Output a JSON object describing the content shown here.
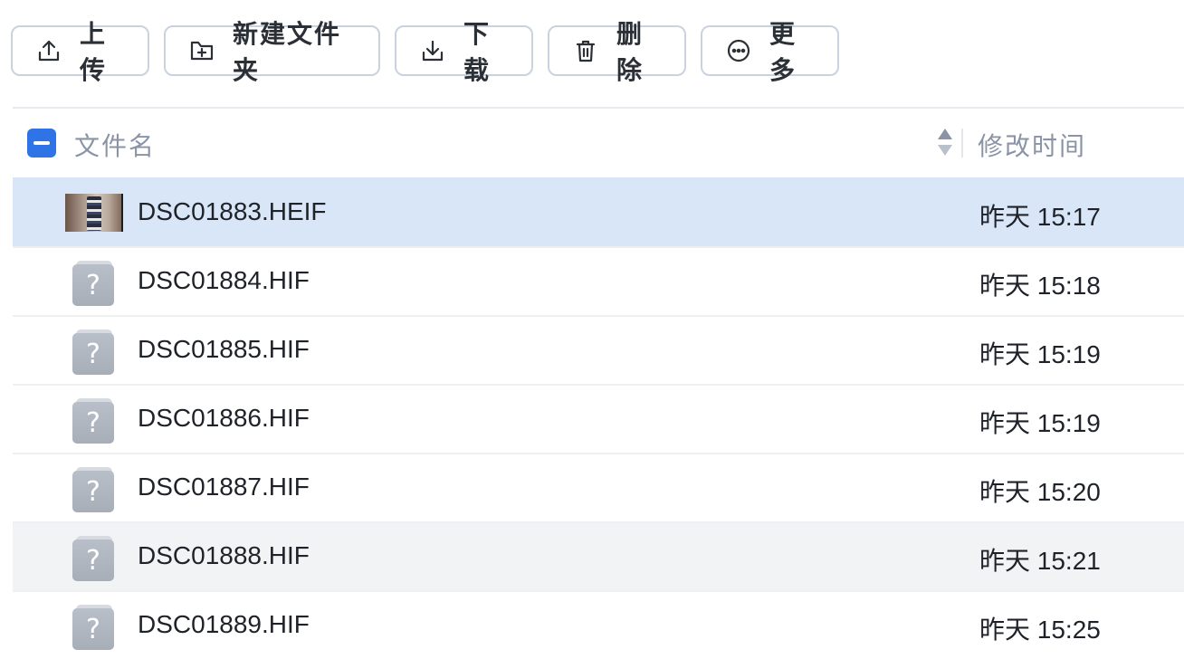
{
  "toolbar": {
    "upload_label": "上传",
    "new_folder_label": "新建文件夹",
    "download_label": "下载",
    "delete_label": "删除",
    "more_label": "更多"
  },
  "table": {
    "header": {
      "name_label": "文件名",
      "time_label": "修改时间"
    },
    "rows": [
      {
        "name": "DSC01883.HEIF",
        "time": "昨天 15:17",
        "icon": "photo-thumbnail"
      },
      {
        "name": "DSC01884.HIF",
        "time": "昨天 15:18",
        "icon": "unknown-file-icon"
      },
      {
        "name": "DSC01885.HIF",
        "time": "昨天 15:19",
        "icon": "unknown-file-icon"
      },
      {
        "name": "DSC01886.HIF",
        "time": "昨天 15:19",
        "icon": "unknown-file-icon"
      },
      {
        "name": "DSC01887.HIF",
        "time": "昨天 15:20",
        "icon": "unknown-file-icon"
      },
      {
        "name": "DSC01888.HIF",
        "time": "昨天 15:21",
        "icon": "unknown-file-icon"
      },
      {
        "name": "DSC01889.HIF",
        "time": "昨天 15:25",
        "icon": "unknown-file-icon"
      }
    ]
  },
  "colors": {
    "accent": "#2f74e6",
    "selected_row": "#d8e6f8",
    "hover_row": "#f2f3f5",
    "header_text": "#8a94a6"
  }
}
